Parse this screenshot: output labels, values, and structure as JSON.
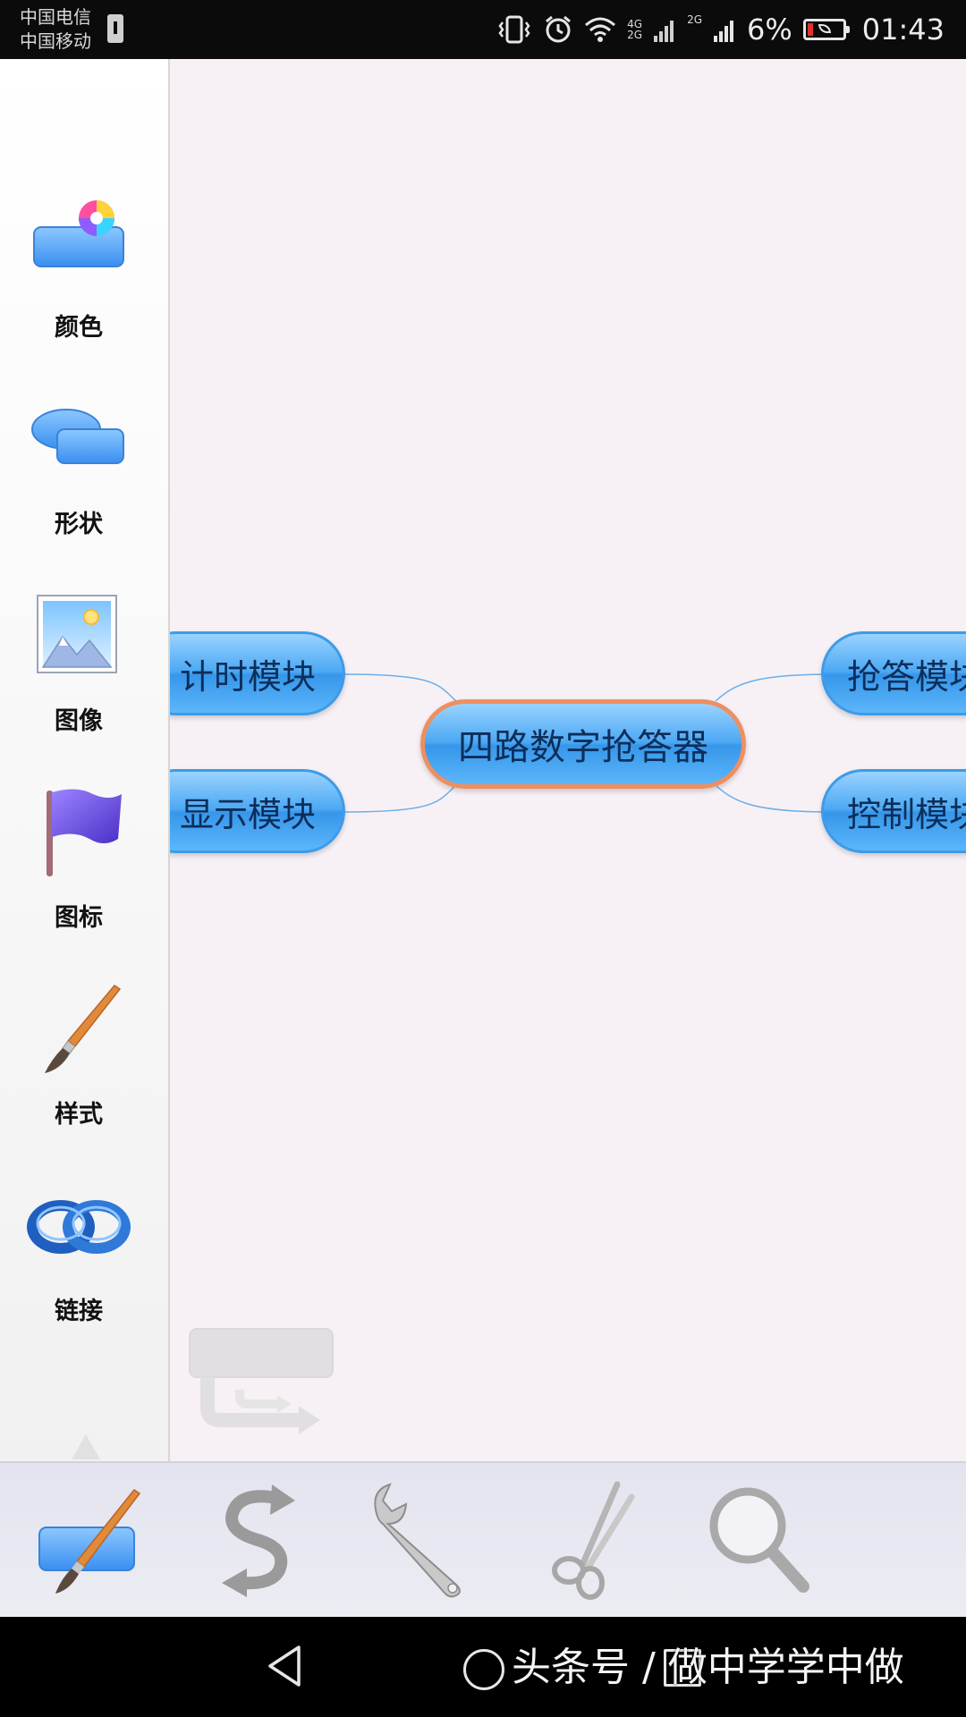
{
  "status_bar": {
    "carrier_1": "中国电信",
    "carrier_2": "中国移动",
    "net_1_top": "4G",
    "net_1_bottom": "2G",
    "net_2": "2G",
    "battery_percent": "6%",
    "time": "01:43"
  },
  "sidebar": {
    "items": [
      {
        "label": "颜色",
        "icon": "color-icon"
      },
      {
        "label": "形状",
        "icon": "shape-icon"
      },
      {
        "label": "图像",
        "icon": "image-icon"
      },
      {
        "label": "图标",
        "icon": "flag-icon"
      },
      {
        "label": "样式",
        "icon": "brush-icon"
      },
      {
        "label": "链接",
        "icon": "link-icon"
      }
    ]
  },
  "mindmap": {
    "central": "四路数字抢答器",
    "left_top": "计时模块",
    "left_bottom": "显示模块",
    "right_top": "抢答模块",
    "right_bottom": "控制模块"
  },
  "toolbar": {
    "tools": [
      "style-tool-icon",
      "undo-icon",
      "wrench-icon",
      "scissors-icon",
      "magnifier-icon"
    ]
  },
  "navbar": {
    "watermark": "头条号 / 做中学学中做"
  },
  "colors": {
    "node_blue": "#4ba8f3",
    "central_border": "#ee8f5f",
    "canvas_bg": "#f7f1f6"
  }
}
